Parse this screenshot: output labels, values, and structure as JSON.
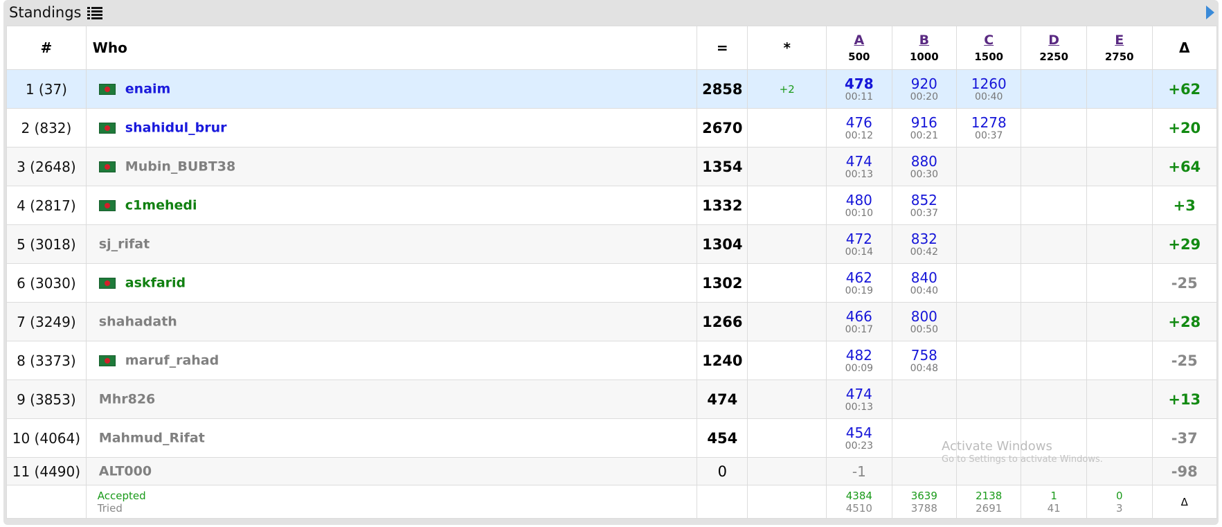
{
  "window": {
    "title": "Standings"
  },
  "colors": {
    "red_handle": "#1414d4",
    "candidate_master": "#0000cc",
    "gray": "#808080",
    "green": "#118011",
    "pos_delta": "#118811",
    "neg_delta": "#888888",
    "problem_link": "#5a2a82"
  },
  "header": {
    "rank": "#",
    "who": "Who",
    "points": "=",
    "hacks": "*",
    "delta": "Δ",
    "problems": [
      {
        "letter": "A",
        "points": "500"
      },
      {
        "letter": "B",
        "points": "1000"
      },
      {
        "letter": "C",
        "points": "1500"
      },
      {
        "letter": "D",
        "points": "2250"
      },
      {
        "letter": "E",
        "points": "2750"
      }
    ]
  },
  "rows": [
    {
      "rank": "1 (37)",
      "flag": true,
      "handle": "enaim",
      "handle_color": "#1a1adc",
      "points": "2858",
      "hacks": "+2",
      "A": {
        "v": "478",
        "t": "00:11",
        "bold": true
      },
      "B": {
        "v": "920",
        "t": "00:20"
      },
      "C": {
        "v": "1260",
        "t": "00:40"
      },
      "delta": "+62",
      "delta_color": "#128a12",
      "highlight": true
    },
    {
      "rank": "2 (832)",
      "flag": true,
      "handle": "shahidul_brur",
      "handle_color": "#1a1adc",
      "points": "2670",
      "hacks": "",
      "A": {
        "v": "476",
        "t": "00:12"
      },
      "B": {
        "v": "916",
        "t": "00:21"
      },
      "C": {
        "v": "1278",
        "t": "00:37"
      },
      "delta": "+20",
      "delta_color": "#128a12"
    },
    {
      "rank": "3 (2648)",
      "flag": true,
      "handle": "Mubin_BUBT38",
      "handle_color": "#808080",
      "points": "1354",
      "hacks": "",
      "A": {
        "v": "474",
        "t": "00:13"
      },
      "B": {
        "v": "880",
        "t": "00:30"
      },
      "delta": "+64",
      "delta_color": "#128a12"
    },
    {
      "rank": "4 (2817)",
      "flag": true,
      "handle": "c1mehedi",
      "handle_color": "#118011",
      "points": "1332",
      "hacks": "",
      "A": {
        "v": "480",
        "t": "00:10"
      },
      "B": {
        "v": "852",
        "t": "00:37"
      },
      "delta": "+3",
      "delta_color": "#128a12"
    },
    {
      "rank": "5 (3018)",
      "flag": false,
      "handle": "sj_rifat",
      "handle_color": "#808080",
      "points": "1304",
      "hacks": "",
      "A": {
        "v": "472",
        "t": "00:14"
      },
      "B": {
        "v": "832",
        "t": "00:42"
      },
      "delta": "+29",
      "delta_color": "#128a12"
    },
    {
      "rank": "6 (3030)",
      "flag": true,
      "handle": "askfarid",
      "handle_color": "#118011",
      "points": "1302",
      "hacks": "",
      "A": {
        "v": "462",
        "t": "00:19"
      },
      "B": {
        "v": "840",
        "t": "00:40"
      },
      "delta": "-25",
      "delta_color": "#888888"
    },
    {
      "rank": "7 (3249)",
      "flag": false,
      "handle": "shahadath",
      "handle_color": "#808080",
      "points": "1266",
      "hacks": "",
      "A": {
        "v": "466",
        "t": "00:17"
      },
      "B": {
        "v": "800",
        "t": "00:50"
      },
      "delta": "+28",
      "delta_color": "#128a12"
    },
    {
      "rank": "8 (3373)",
      "flag": true,
      "handle": "maruf_rahad",
      "handle_color": "#808080",
      "points": "1240",
      "hacks": "",
      "A": {
        "v": "482",
        "t": "00:09"
      },
      "B": {
        "v": "758",
        "t": "00:48"
      },
      "delta": "-25",
      "delta_color": "#888888"
    },
    {
      "rank": "9 (3853)",
      "flag": false,
      "handle": "Mhr826",
      "handle_color": "#808080",
      "points": "474",
      "hacks": "",
      "A": {
        "v": "474",
        "t": "00:13"
      },
      "delta": "+13",
      "delta_color": "#128a12"
    },
    {
      "rank": "10 (4064)",
      "flag": false,
      "handle": "Mahmud_Rifat",
      "handle_color": "#808080",
      "points": "454",
      "hacks": "",
      "A": {
        "v": "454",
        "t": "00:23"
      },
      "delta": "-37",
      "delta_color": "#888888"
    },
    {
      "rank": "11 (4490)",
      "flag": false,
      "handle": "ALT000",
      "handle_color": "#808080",
      "points": "0",
      "points_bold": false,
      "hacks": "",
      "A": {
        "neg": "-1"
      },
      "delta": "-98",
      "delta_color": "#888888",
      "short": true
    }
  ],
  "footer": {
    "accepted_label": "Accepted",
    "tried_label": "Tried",
    "stats": [
      {
        "accepted": "4384",
        "tried": "4510"
      },
      {
        "accepted": "3639",
        "tried": "3788"
      },
      {
        "accepted": "2138",
        "tried": "2691"
      },
      {
        "accepted": "1",
        "tried": "41"
      },
      {
        "accepted": "0",
        "tried": "3"
      }
    ],
    "delta": "Δ"
  },
  "watermark": {
    "line1": "Activate Windows",
    "line2": "Go to Settings to activate Windows."
  }
}
